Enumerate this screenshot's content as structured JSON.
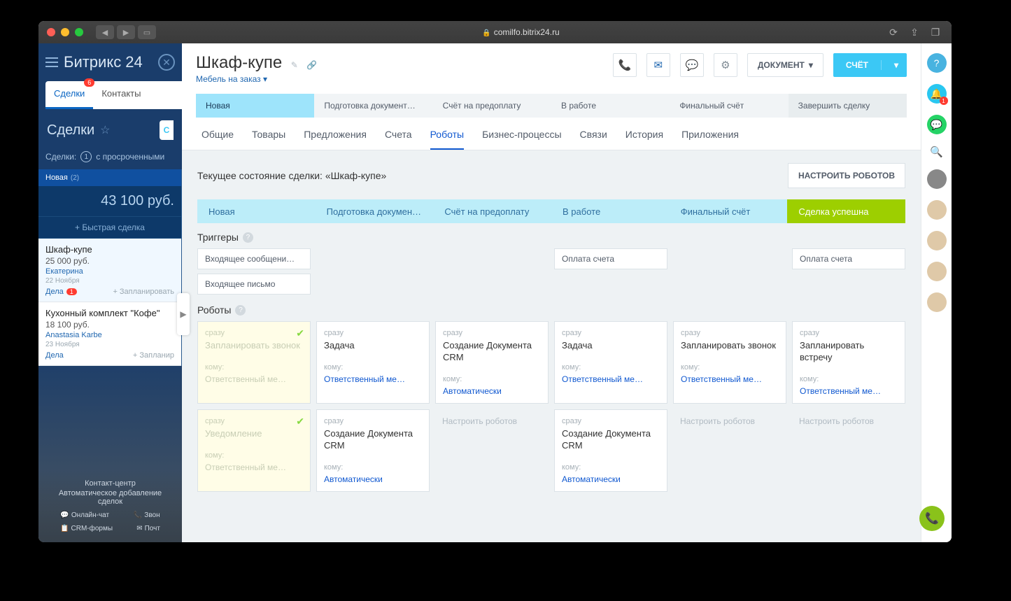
{
  "browser": {
    "url": "comilfo.bitrix24.ru"
  },
  "logo": "Битрикс 24",
  "crm_tabs": {
    "deals": "Сделки",
    "contacts": "Контакты",
    "deals_badge": "6"
  },
  "left": {
    "header": "Сделки",
    "overdue_prefix": "Сделки:",
    "overdue_count": "1",
    "overdue_text": "с просроченными",
    "stage_name": "Новая",
    "stage_count": "(2)",
    "stage_sum": "43 100 руб.",
    "quick": "+  Быстрая сделка",
    "deal1": {
      "title": "Шкаф-купе",
      "price": "25 000 руб.",
      "user": "Екатерина",
      "date": "22 Ноября",
      "dela": "Дела",
      "dela_badge": "1",
      "plan": "+ Запланировать"
    },
    "deal2": {
      "title": "Кухонный комплект \"Кофе\"",
      "price": "18 100 руб.",
      "user": "Anastasia Karbe",
      "date": "23 Ноября",
      "dela": "Дела",
      "plan": "+ Запланир"
    },
    "cc_title": "Контакт-центр",
    "cc_sub": "Автоматическое добавление сделок",
    "cc_icons": [
      "Онлайн-чат",
      "Звон",
      "CRM-формы",
      "Почт"
    ]
  },
  "detail": {
    "title": "Шкаф-купе",
    "subtitle": "Мебель на заказ",
    "doc_btn": "ДОКУМЕНТ",
    "invoice_btn": "СЧЁТ",
    "stages": [
      "Новая",
      "Подготовка документ…",
      "Счёт на предоплату",
      "В работе",
      "Финальный счёт",
      "Завершить сделку"
    ],
    "sub_tabs": [
      "Общие",
      "Товары",
      "Предложения",
      "Счета",
      "Роботы",
      "Бизнес-процессы",
      "Связи",
      "История",
      "Приложения"
    ],
    "active_sub": 4
  },
  "content": {
    "state_label": "Текущее состояние сделки: «Шкаф-купе»",
    "config_btn": "НАСТРОИТЬ РОБОТОВ",
    "mini_stages": [
      "Новая",
      "Подготовка докумен…",
      "Счёт на предоплату",
      "В работе",
      "Финальный счёт",
      "Сделка успешна"
    ],
    "triggers_label": "Триггеры",
    "robots_label": "Роботы",
    "triggers": {
      "col0": [
        "Входящее сообщени…",
        "Входящее письмо"
      ],
      "col3": [
        "Оплата счета"
      ],
      "col5": [
        "Оплата счета"
      ]
    },
    "robots_row1": [
      {
        "when": "сразу",
        "title": "Запланировать звонок",
        "kmu": "кому:",
        "resp": "Ответственный ме…",
        "done": true
      },
      {
        "when": "сразу",
        "title": "Задача",
        "kmu": "кому:",
        "resp": "Ответственный ме…"
      },
      {
        "when": "сразу",
        "title": "Создание Документа CRM",
        "kmu": "кому:",
        "resp": "Автоматически"
      },
      {
        "when": "сразу",
        "title": "Задача",
        "kmu": "кому:",
        "resp": "Ответственный ме…"
      },
      {
        "when": "сразу",
        "title": "Запланировать звонок",
        "kmu": "кому:",
        "resp": "Ответственный ме…"
      },
      {
        "when": "сразу",
        "title": "Запланировать встречу",
        "kmu": "кому:",
        "resp": "Ответственный ме…"
      }
    ],
    "robots_row2": [
      {
        "when": "сразу",
        "title": "Уведомление",
        "kmu": "кому:",
        "resp": "Ответственный ме…",
        "done": true
      },
      {
        "when": "сразу",
        "title": "Создание Документа CRM",
        "kmu": "кому:",
        "resp": "Автоматически"
      },
      {
        "placeholder": "Настроить роботов"
      },
      {
        "when": "сразу",
        "title": "Создание Документа CRM",
        "kmu": "кому:",
        "resp": "Автоматически"
      },
      {
        "placeholder": "Настроить роботов"
      },
      {
        "placeholder": "Настроить роботов"
      }
    ]
  },
  "rail": {
    "bell_badge": "1"
  }
}
